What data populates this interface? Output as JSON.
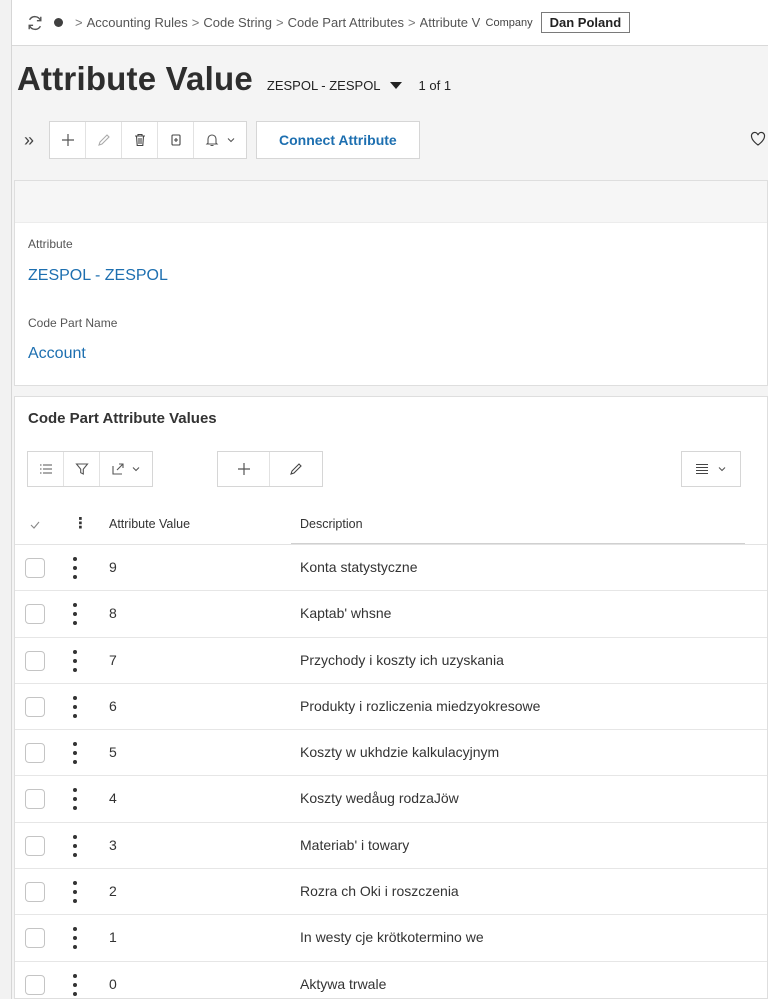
{
  "breadcrumb": {
    "items": [
      "Accounting Rules",
      "Code String",
      "Code Part Attributes",
      "Attribute Value"
    ],
    "company_label": "Company",
    "company_value": "Dan Poland"
  },
  "header": {
    "title": "Attribute Value",
    "record": "ZESPOL - ZESPOL",
    "paging": "1 of 1"
  },
  "toolbar": {
    "connect_label": "Connect Attribute"
  },
  "details": {
    "attribute_label": "Attribute",
    "attribute_value": "ZESPOL  - ZESPOL",
    "code_part_label": "Code Part Name",
    "code_part_value": "Account"
  },
  "list": {
    "title": "Code Part Attribute Values",
    "columns": [
      "Attribute Value",
      "Description"
    ],
    "rows": [
      {
        "value": "9",
        "description": "Konta statystyczne"
      },
      {
        "value": "8",
        "description": "Kaptab' whsne"
      },
      {
        "value": "7",
        "description": "Przychody i koszty ich uzyskania"
      },
      {
        "value": "6",
        "description": "Produkty i rozliczenia miedzyokresowe"
      },
      {
        "value": "5",
        "description": "Koszty w ukhdzie kalkulacyjnym"
      },
      {
        "value": "4",
        "description": "Koszty wedåug rodzaJöw"
      },
      {
        "value": "3",
        "description": "Materiab' i towary"
      },
      {
        "value": "2",
        "description": "Rozra ch Oki i roszczenia"
      },
      {
        "value": "1",
        "description": "In westy cje krötkotermino we"
      },
      {
        "value": "0",
        "description": "Aktywa trwale"
      }
    ]
  },
  "colors": {
    "accent": "#1d6fb0",
    "text": "#2b2b2b",
    "border": "#d6d6d6"
  }
}
